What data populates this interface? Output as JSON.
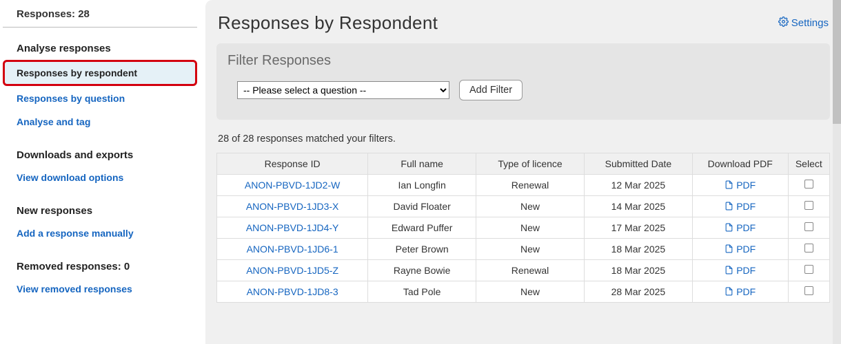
{
  "sidebar": {
    "title": "Responses: 28",
    "sections": [
      {
        "heading": "Analyse responses",
        "items": [
          {
            "label": "Responses by respondent",
            "active": true
          },
          {
            "label": "Responses by question"
          },
          {
            "label": "Analyse and tag"
          }
        ]
      },
      {
        "heading": "Downloads and exports",
        "items": [
          {
            "label": "View download options"
          }
        ]
      },
      {
        "heading": "New responses",
        "items": [
          {
            "label": "Add a response manually"
          }
        ]
      },
      {
        "heading": "Removed responses: 0",
        "items": [
          {
            "label": "View removed responses"
          }
        ]
      }
    ]
  },
  "header": {
    "title": "Responses by Respondent",
    "settings_label": "Settings"
  },
  "filter": {
    "panel_title": "Filter Responses",
    "select_placeholder": "-- Please select a question --",
    "add_filter_label": "Add Filter"
  },
  "summary": "28 of 28 responses matched your filters.",
  "table": {
    "headers": {
      "id": "Response ID",
      "name": "Full name",
      "type": "Type of licence",
      "date": "Submitted Date",
      "pdf": "Download PDF",
      "select": "Select"
    },
    "pdf_label": "PDF",
    "rows": [
      {
        "id": "ANON-PBVD-1JD2-W",
        "name": "Ian Longfin",
        "type": "Renewal",
        "date": "12 Mar 2025"
      },
      {
        "id": "ANON-PBVD-1JD3-X",
        "name": "David Floater",
        "type": "New",
        "date": "14 Mar 2025"
      },
      {
        "id": "ANON-PBVD-1JD4-Y",
        "name": "Edward Puffer",
        "type": "New",
        "date": "17 Mar 2025"
      },
      {
        "id": "ANON-PBVD-1JD6-1",
        "name": "Peter Brown",
        "type": "New",
        "date": "18 Mar 2025"
      },
      {
        "id": "ANON-PBVD-1JD5-Z",
        "name": "Rayne Bowie",
        "type": "Renewal",
        "date": "18 Mar 2025"
      },
      {
        "id": "ANON-PBVD-1JD8-3",
        "name": "Tad Pole",
        "type": "New",
        "date": "28 Mar 2025"
      }
    ]
  }
}
